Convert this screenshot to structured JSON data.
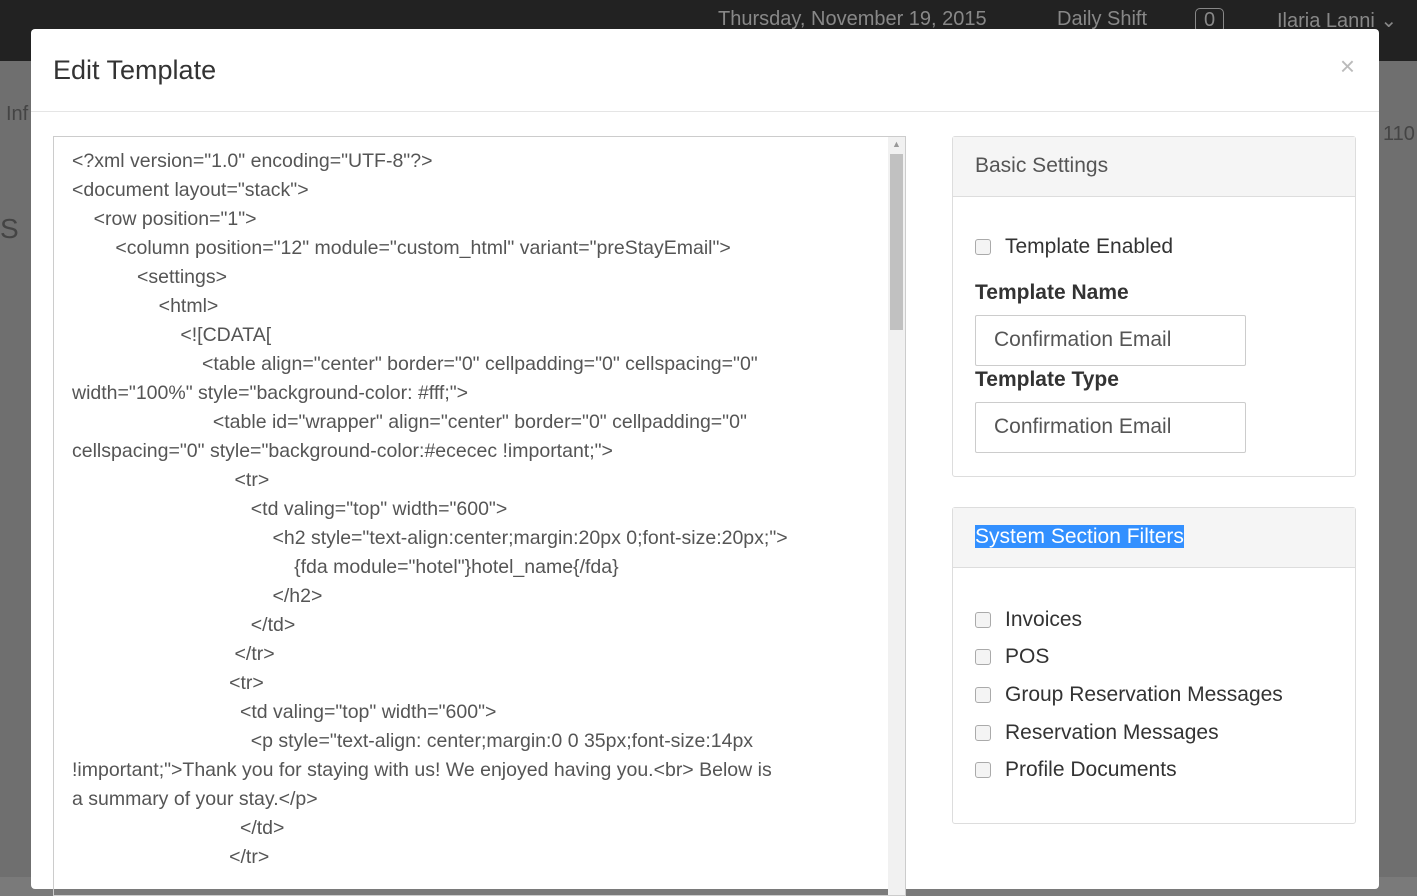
{
  "topbar": {
    "date": "Thursday, November 19, 2015",
    "shift": "Daily Shift",
    "count": "0",
    "user": "Ilaria Lanni"
  },
  "background": {
    "left_text": "Inf",
    "left_text2": "S",
    "right_text": "110"
  },
  "modal": {
    "title": "Edit Template",
    "close": "×"
  },
  "editor": {
    "content": "<?xml version=\"1.0\" encoding=\"UTF-8\"?>\n<document layout=\"stack\">\n    <row position=\"1\">\n        <column position=\"12\" module=\"custom_html\" variant=\"preStayEmail\">\n            <settings>\n                <html>\n                    <![CDATA[\n                        <table align=\"center\" border=\"0\" cellpadding=\"0\" cellspacing=\"0\"\nwidth=\"100%\" style=\"background-color: #fff;\">\n                          <table id=\"wrapper\" align=\"center\" border=\"0\" cellpadding=\"0\"\ncellspacing=\"0\" style=\"background-color:#ececec !important;\">\n                              <tr>\n                                 <td valing=\"top\" width=\"600\">\n                                     <h2 style=\"text-align:center;margin:20px 0;font-size:20px;\">\n                                         {fda module=\"hotel\"}hotel_name{/fda}\n                                     </h2>\n                                 </td>\n                              </tr>\n                             <tr>\n                               <td valing=\"top\" width=\"600\">\n                                 <p style=\"text-align: center;margin:0 0 35px;font-size:14px\n!important;\">Thank you for staying with us! We enjoyed having you.<br> Below is\na summary of your stay.</p>\n                               </td>\n                             </tr>"
  },
  "basic": {
    "title": "Basic Settings",
    "enabled_label": "Template Enabled",
    "enabled": false,
    "name_label": "Template Name",
    "name_value": "Confirmation Email",
    "type_label": "Template Type",
    "type_value": "Confirmation Email"
  },
  "filters": {
    "title": "System Section Filters",
    "items": [
      {
        "label": "Invoices",
        "checked": false
      },
      {
        "label": "POS",
        "checked": false
      },
      {
        "label": "Group Reservation Messages",
        "checked": false
      },
      {
        "label": "Reservation Messages",
        "checked": false
      },
      {
        "label": "Profile Documents",
        "checked": false
      }
    ]
  }
}
